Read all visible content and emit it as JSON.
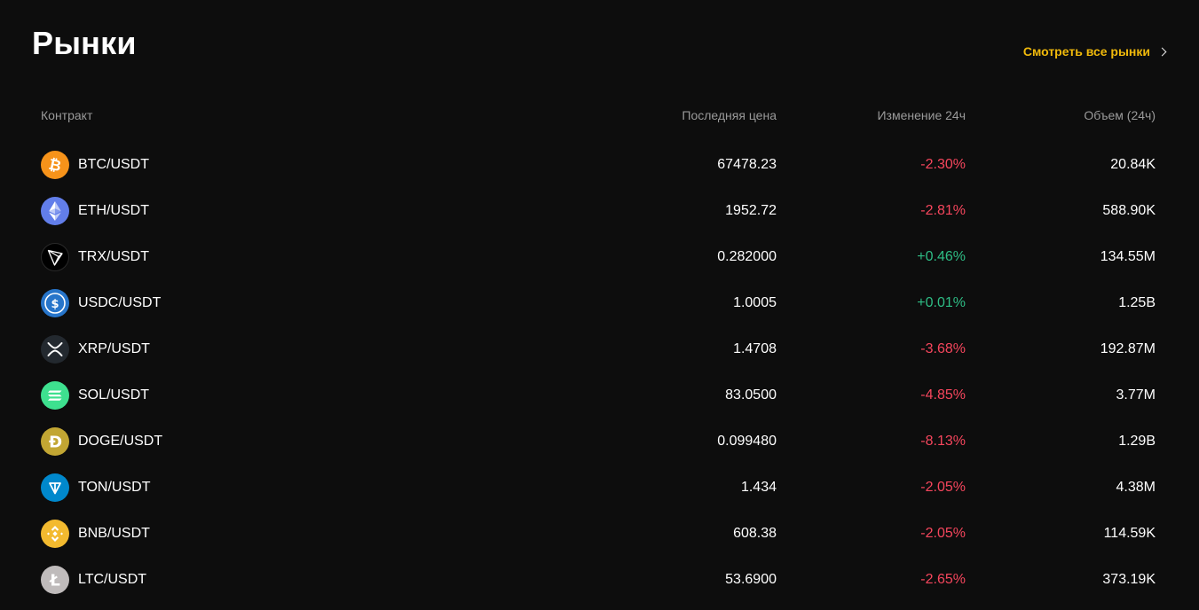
{
  "header": {
    "title": "Рынки",
    "see_all_label": "Смотреть все рынки"
  },
  "table": {
    "columns": {
      "contract": "Контракт",
      "price": "Последняя цена",
      "change": "Изменение 24ч",
      "volume": "Объем (24ч)"
    },
    "rows": [
      {
        "pair": "BTC/USDT",
        "price": "67478.23",
        "change": "-2.30%",
        "direction": "down",
        "volume": "20.84K",
        "icon": "btc-icon",
        "color": "#f7931a"
      },
      {
        "pair": "ETH/USDT",
        "price": "1952.72",
        "change": "-2.81%",
        "direction": "down",
        "volume": "588.90K",
        "icon": "eth-icon",
        "color": "#627eea"
      },
      {
        "pair": "TRX/USDT",
        "price": "0.282000",
        "change": "+0.46%",
        "direction": "up",
        "volume": "134.55M",
        "icon": "trx-icon",
        "color": "#000000"
      },
      {
        "pair": "USDC/USDT",
        "price": "1.0005",
        "change": "+0.01%",
        "direction": "up",
        "volume": "1.25B",
        "icon": "usdc-icon",
        "color": "#2775ca"
      },
      {
        "pair": "XRP/USDT",
        "price": "1.4708",
        "change": "-3.68%",
        "direction": "down",
        "volume": "192.87M",
        "icon": "xrp-icon",
        "color": "#23292f"
      },
      {
        "pair": "SOL/USDT",
        "price": "83.0500",
        "change": "-4.85%",
        "direction": "down",
        "volume": "3.77M",
        "icon": "sol-icon",
        "color": "#3ee08f"
      },
      {
        "pair": "DOGE/USDT",
        "price": "0.099480",
        "change": "-8.13%",
        "direction": "down",
        "volume": "1.29B",
        "icon": "doge-icon",
        "color": "#c2a633"
      },
      {
        "pair": "TON/USDT",
        "price": "1.434",
        "change": "-2.05%",
        "direction": "down",
        "volume": "4.38M",
        "icon": "ton-icon",
        "color": "#0088cc"
      },
      {
        "pair": "BNB/USDT",
        "price": "608.38",
        "change": "-2.05%",
        "direction": "down",
        "volume": "114.59K",
        "icon": "bnb-icon",
        "color": "#f3ba2f"
      },
      {
        "pair": "LTC/USDT",
        "price": "53.6900",
        "change": "-2.65%",
        "direction": "down",
        "volume": "373.19K",
        "icon": "ltc-icon",
        "color": "#bfbbbb"
      }
    ]
  },
  "colors": {
    "background": "#0d0d0d",
    "accent": "#f0b90b",
    "negative": "#f6465d",
    "positive": "#2ebd85",
    "muted": "#9a9a9a"
  }
}
